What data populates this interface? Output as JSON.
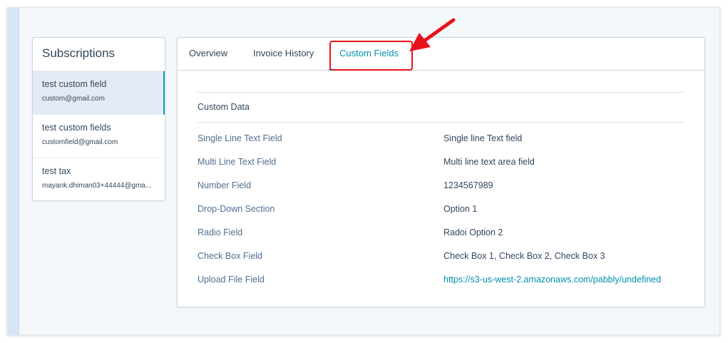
{
  "subscriptions": {
    "title": "Subscriptions",
    "items": [
      {
        "name": "test custom field",
        "email": "custom@gmail.com"
      },
      {
        "name": "test custom fields",
        "email": "customfield@gmail.com"
      },
      {
        "name": "test tax",
        "email": "mayank.dhiman03+44444@gma..."
      }
    ]
  },
  "tabs": [
    {
      "label": "Overview"
    },
    {
      "label": "Invoice History"
    },
    {
      "label": "Custom Fields"
    }
  ],
  "custom_data": {
    "title": "Custom Data",
    "fields": [
      {
        "label": "Single Line Text Field",
        "value": "Single line Text field"
      },
      {
        "label": "Multi Line Text Field",
        "value": "Multi line text area field"
      },
      {
        "label": "Number Field",
        "value": "1234567989"
      },
      {
        "label": "Drop-Down Section",
        "value": "Option 1"
      },
      {
        "label": "Radio Field",
        "value": "Radoi Option 2"
      },
      {
        "label": "Check Box Field",
        "value": "Check Box 1, Check Box 2, Check Box 3"
      },
      {
        "label": "Upload File Field",
        "value": "https://s3-us-west-2.amazonaws.com/pabbly/undefined"
      }
    ]
  },
  "colors": {
    "accent": "#00a4bd",
    "link": "#0091ae",
    "annotation": "#e8131a"
  }
}
